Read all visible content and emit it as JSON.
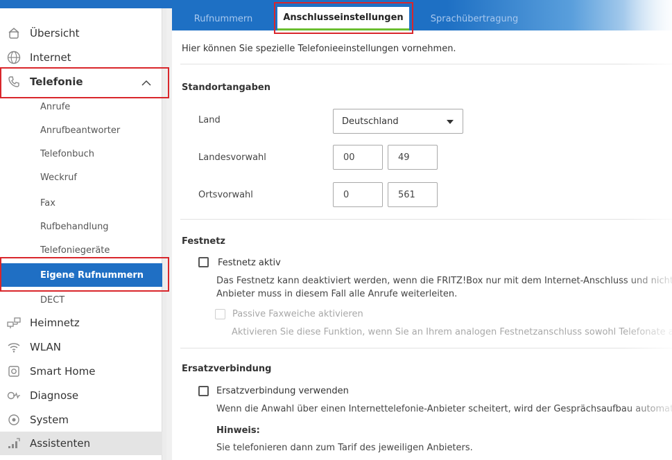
{
  "sidebar": {
    "items": [
      {
        "label": "Übersicht",
        "icon": "home-icon"
      },
      {
        "label": "Internet",
        "icon": "globe-icon"
      },
      {
        "label": "Telefonie",
        "icon": "phone-icon"
      },
      {
        "label": "Heimnetz",
        "icon": "network-icon"
      },
      {
        "label": "WLAN",
        "icon": "wifi-icon"
      },
      {
        "label": "Smart Home",
        "icon": "smarthome-icon"
      },
      {
        "label": "Diagnose",
        "icon": "diagnose-icon"
      },
      {
        "label": "System",
        "icon": "system-icon"
      },
      {
        "label": "Assistenten",
        "icon": "assistant-icon"
      }
    ],
    "telefonie_sub": [
      "Anrufe",
      "Anrufbeantworter",
      "Telefonbuch",
      "Weckruf",
      "Fax",
      "Rufbehandlung",
      "Telefoniegeräte",
      "Eigene Rufnummern",
      "DECT"
    ],
    "active_sub": "Eigene Rufnummern"
  },
  "tabs": [
    {
      "label": "Rufnummern",
      "active": false
    },
    {
      "label": "Anschlusseinstellungen",
      "active": true
    },
    {
      "label": "Sprachübertragung",
      "active": false
    }
  ],
  "intro": "Hier können Sie spezielle Telefonieeinstellungen vornehmen.",
  "standort": {
    "title": "Standortangaben",
    "land_label": "Land",
    "land_value": "Deutschland",
    "landesvorwahl_label": "Landesvorwahl",
    "landesvorwahl_prefix": "00",
    "landesvorwahl_value": "49",
    "ortsvorwahl_label": "Ortsvorwahl",
    "ortsvorwahl_prefix": "0",
    "ortsvorwahl_value": "561"
  },
  "festnetz": {
    "title": "Festnetz",
    "aktiv_label": "Festnetz aktiv",
    "desc1": "Das Festnetz kann deaktiviert werden, wenn die FRITZ!Box nur mit dem Internet-Anschluss und nicht mi",
    "desc2": "Anbieter muss in diesem Fall alle Anrufe weiterleiten.",
    "faxweiche_label": "Passive Faxweiche aktivieren",
    "faxweiche_desc": "Aktivieren Sie diese Funktion, wenn Sie an Ihrem analogen Festnetzanschluss sowohl Telefonate al"
  },
  "ersatz": {
    "title": "Ersatzverbindung",
    "checkbox_label": "Ersatzverbindung verwenden",
    "desc": "Wenn die Anwahl über einen Internettelefonie-Anbieter scheitert, wird der Gesprächsaufbau automatis",
    "hinweis_title": "Hinweis:",
    "hinweis_text": "Sie telefonieren dann zum Tarif des jeweiligen Anbieters."
  },
  "colors": {
    "accent": "#1f6fc4",
    "highlight": "#d9262b",
    "tab_underline": "#6bbd2f"
  }
}
